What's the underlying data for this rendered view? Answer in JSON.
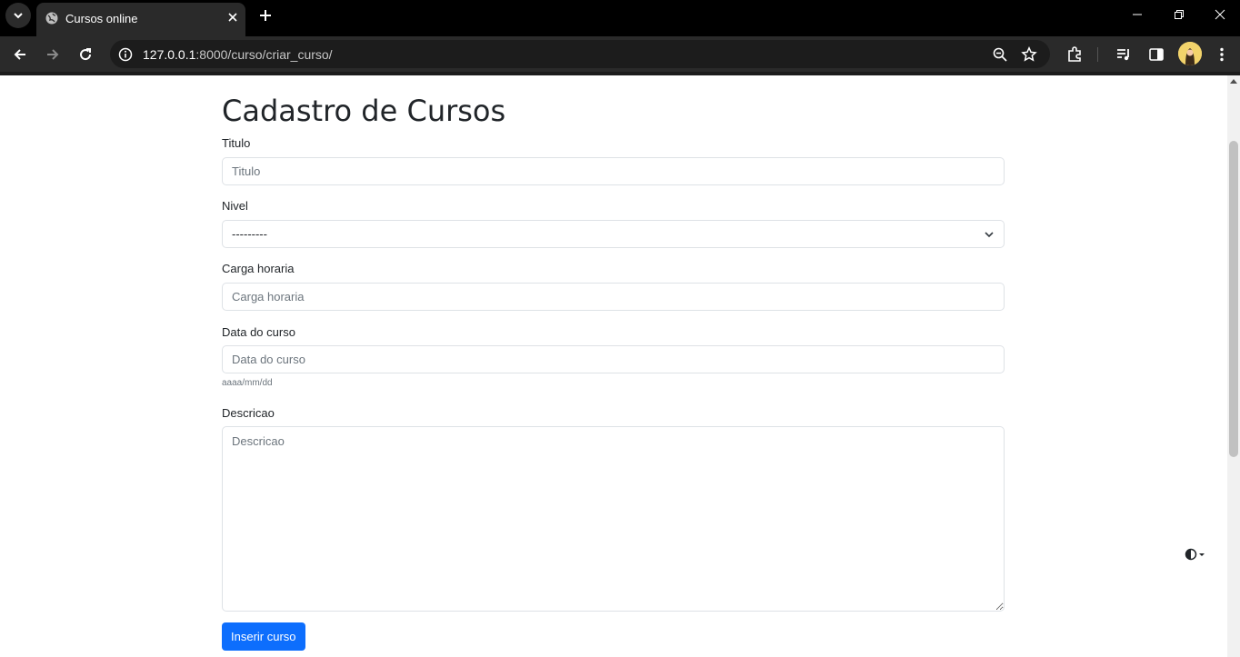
{
  "browser": {
    "tab_title": "Cursos online",
    "url_host": "127.0.0.1",
    "url_rest": ":8000/curso/criar_curso/"
  },
  "page": {
    "heading": "Cadastro de Cursos",
    "form": {
      "titulo": {
        "label": "Titulo",
        "placeholder": "Titulo",
        "value": ""
      },
      "nivel": {
        "label": "Nivel",
        "selected": "---------"
      },
      "carga_horaria": {
        "label": "Carga horaria",
        "placeholder": "Carga horaria",
        "value": ""
      },
      "data_curso": {
        "label": "Data do curso",
        "placeholder": "Data do curso",
        "help": "aaaa/mm/dd",
        "value": ""
      },
      "descricao": {
        "label": "Descricao",
        "placeholder": "Descricao",
        "value": ""
      },
      "submit_label": "Inserir curso"
    }
  },
  "colors": {
    "primary": "#0d6efd",
    "chrome_dark": "#000000",
    "toolbar": "#2a2a2a"
  },
  "icons": [
    "tab-search-icon",
    "globe-icon",
    "close-icon",
    "plus-icon",
    "minimize-icon",
    "restore-icon",
    "back-icon",
    "forward-icon",
    "reload-icon",
    "info-icon",
    "zoom-icon",
    "star-icon",
    "extensions-icon",
    "media-icon",
    "side-panel-icon",
    "menu-icon",
    "theme-toggle-icon"
  ]
}
